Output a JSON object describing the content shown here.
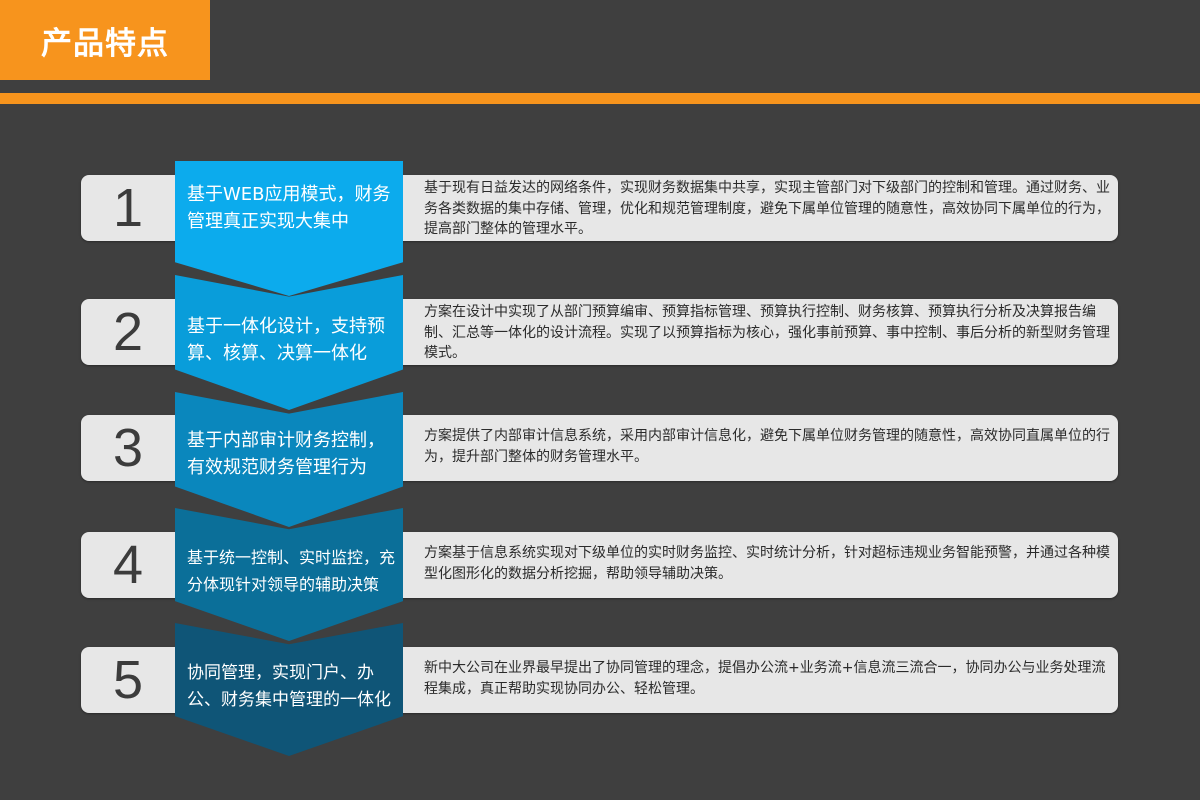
{
  "header": {
    "title": "产品特点",
    "accent_color": "#f7941d"
  },
  "features": [
    {
      "number": "1",
      "title": "基于WEB应用模式，财务管理真正实现大集中",
      "description": "基于现有日益发达的网络条件，实现财务数据集中共享，实现主管部门对下级部门的控制和管理。通过财务、业务各类数据的集中存储、管理，优化和规范管理制度，避免下属单位管理的随意性，高效协同下属单位的行为，提高部门整体的管理水平。",
      "color": "#0cabed"
    },
    {
      "number": "2",
      "title": "基于一体化设计，支持预算、核算、决算一体化",
      "description": "方案在设计中实现了从部门预算编审、预算指标管理、预算执行控制、财务核算、预算执行分析及决算报告编制、汇总等一体化的设计流程。实现了以预算指标为核心，强化事前预算、事中控制、事后分析的新型财务管理模式。",
      "color": "#099dda"
    },
    {
      "number": "3",
      "title": "基于内部审计财务控制，有效规范财务管理行为",
      "description": "方案提供了内部审计信息系统，采用内部审计信息化，避免下属单位财务管理的随意性，高效协同直属单位的行为，提升部门整体的财务管理水平。",
      "color": "#0a87bd"
    },
    {
      "number": "4",
      "title": "基于统一控制、实时监控，充分体现针对领导的辅助决策",
      "description": "方案基于信息系统实现对下级单位的实时财务监控、实时统计分析，针对超标违规业务智能预警，并通过各种模型化图形化的数据分析挖掘，帮助领导辅助决策。",
      "color": "#0b6f99"
    },
    {
      "number": "5",
      "title": "协同管理，实现门户、办公、财务集中管理的一体化",
      "description": "新中大公司在业界最早提出了协同管理的理念，提倡办公流+业务流+信息流三流合一，协同办公与业务处理流程集成，真正帮助实现协同办公、轻松管理。",
      "color": "#0f5577"
    }
  ]
}
